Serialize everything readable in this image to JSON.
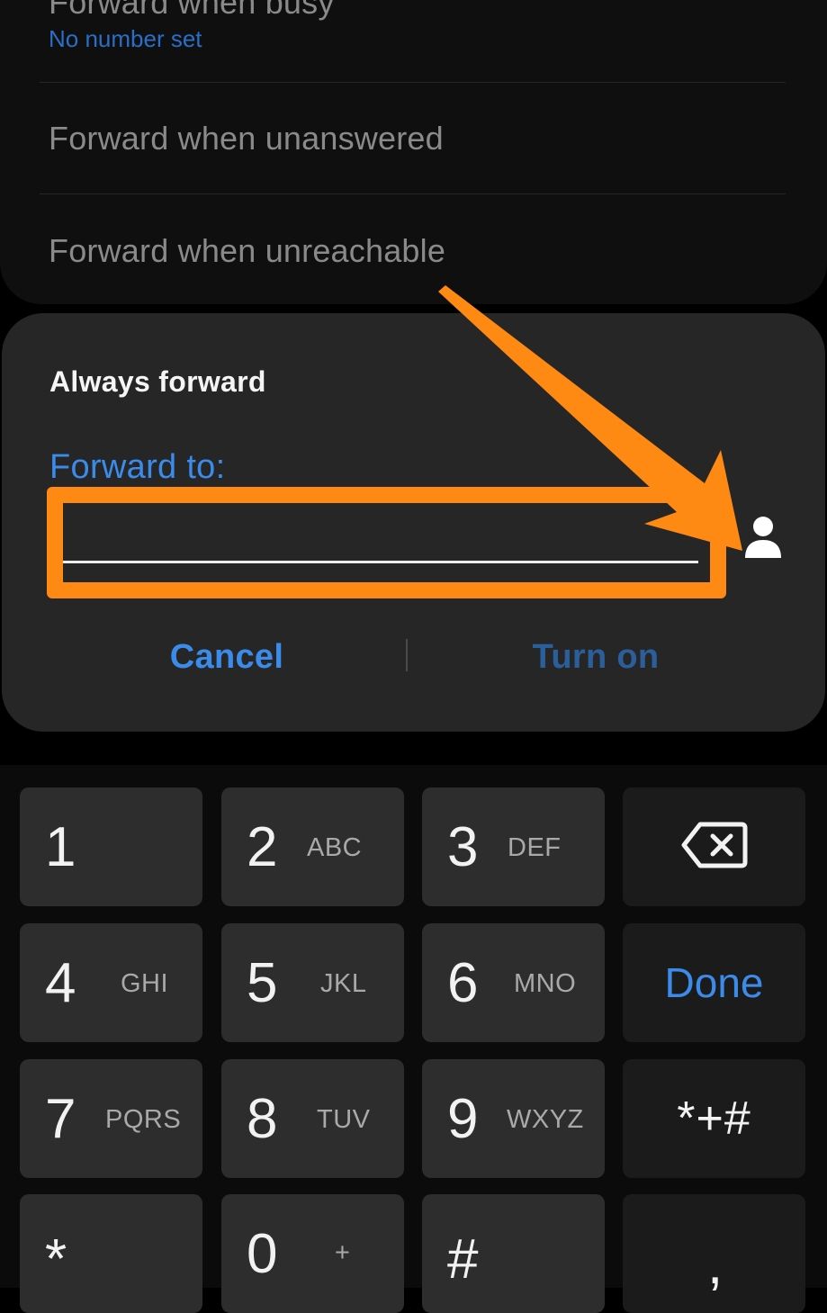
{
  "settings": {
    "busy_title": "Forward when busy",
    "busy_subtitle": "No number set",
    "unanswered_title": "Forward when unanswered",
    "unreachable_title": "Forward when unreachable"
  },
  "dialog": {
    "title": "Always forward",
    "field_label": "Forward to:",
    "field_value": "",
    "cancel_label": "Cancel",
    "turn_on_label": "Turn on",
    "contact_icon": "person-icon"
  },
  "annotation": {
    "color": "#ff8a13"
  },
  "keypad": {
    "keys": [
      {
        "digit": "1",
        "letters": ""
      },
      {
        "digit": "2",
        "letters": "ABC"
      },
      {
        "digit": "3",
        "letters": "DEF"
      },
      {
        "digit": "4",
        "letters": "GHI"
      },
      {
        "digit": "5",
        "letters": "JKL"
      },
      {
        "digit": "6",
        "letters": "MNO"
      },
      {
        "digit": "7",
        "letters": "PQRS"
      },
      {
        "digit": "8",
        "letters": "TUV"
      },
      {
        "digit": "9",
        "letters": "WXYZ"
      },
      {
        "digit": "*",
        "letters": ""
      },
      {
        "digit": "0",
        "letters": "+"
      },
      {
        "digit": "#",
        "letters": ""
      }
    ],
    "backspace_icon": "backspace-icon",
    "done_label": "Done",
    "symbols_label": "*+#",
    "comma_label": ","
  },
  "colors": {
    "accent": "#3b8beb",
    "accent_disabled": "#2b5f9c",
    "dialog_bg": "#262626",
    "key_bg": "#2d2d2d",
    "highlight": "#ff8a13"
  }
}
